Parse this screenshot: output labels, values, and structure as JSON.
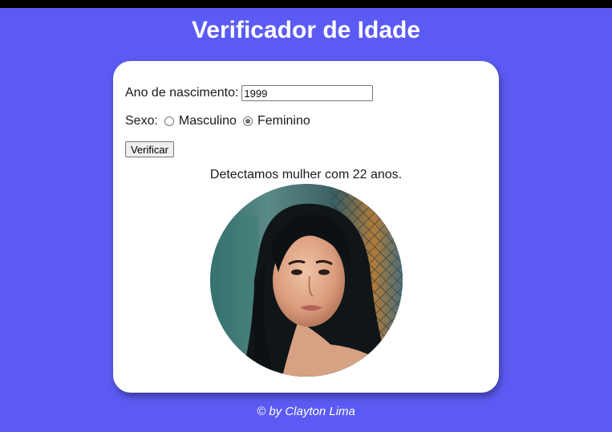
{
  "page": {
    "title": "Verificador de Idade",
    "footer": "© by Clayton Lima"
  },
  "form": {
    "birth_label": "Ano de nascimento:",
    "birth_value": "1999",
    "sex_label": "Sexo:",
    "options": [
      {
        "label": "Masculino",
        "checked": false
      },
      {
        "label": "Feminino",
        "checked": true
      }
    ],
    "button_label": "Verificar"
  },
  "result": {
    "text": "Detectamos mulher com 22 anos.",
    "image_alt": "woman portrait photo"
  },
  "colors": {
    "background": "#5b5bf3",
    "card": "#ffffff"
  }
}
